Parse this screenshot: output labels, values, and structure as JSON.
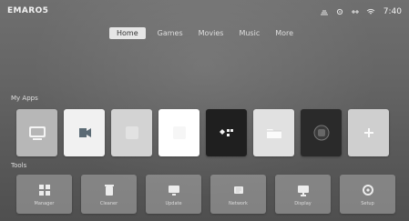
{
  "brand": "EMARO5",
  "statusbar": {
    "time": "7:40",
    "icons": [
      "network-icon",
      "settings-icon",
      "usb-icon",
      "wifi-icon"
    ]
  },
  "tabs": [
    {
      "label": "Home",
      "active": true
    },
    {
      "label": "Games",
      "active": false
    },
    {
      "label": "Movies",
      "active": false
    },
    {
      "label": "Music",
      "active": false
    },
    {
      "label": "More",
      "active": false
    }
  ],
  "sections": {
    "apps_title": "My Apps",
    "tools_title": "Tools"
  },
  "apps": [
    {
      "name": "screen-cast",
      "bg": "#b7b7b7",
      "icon": "cast-icon"
    },
    {
      "name": "media",
      "bg": "#f1f1f1",
      "icon": "video-icon"
    },
    {
      "name": "app-3",
      "bg": "#d3d3d3",
      "icon": "blank-icon"
    },
    {
      "name": "app-4",
      "bg": "#ffffff",
      "icon": "blank-icon"
    },
    {
      "name": "app-5",
      "bg": "#1f1f1f",
      "icon": "controller-icon"
    },
    {
      "name": "file-manager",
      "bg": "#e1e1e1",
      "icon": "folder-icon"
    },
    {
      "name": "app-7",
      "bg": "#2a2a2a",
      "icon": "emblem-icon"
    },
    {
      "name": "add-app",
      "bg": "#cfcfcf",
      "icon": "plus-icon"
    }
  ],
  "tools": [
    {
      "label": "Manager",
      "icon": "grid-icon"
    },
    {
      "label": "Cleaner",
      "icon": "trash-icon"
    },
    {
      "label": "Update",
      "icon": "monitor-icon"
    },
    {
      "label": "Network",
      "icon": "network-icon"
    },
    {
      "label": "Display",
      "icon": "display-icon"
    },
    {
      "label": "Setup",
      "icon": "gear-icon"
    }
  ]
}
